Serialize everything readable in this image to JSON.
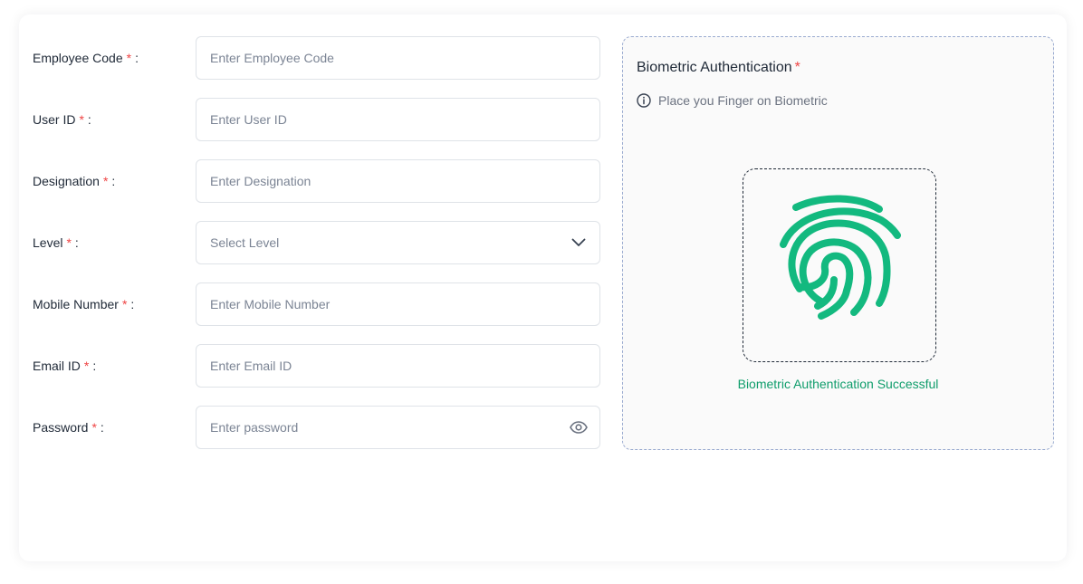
{
  "form": {
    "required_marker": "*",
    "separator": ":",
    "fields": [
      {
        "label": "Employee Code",
        "placeholder": "Enter Employee Code",
        "value": ""
      },
      {
        "label": "User ID",
        "placeholder": "Enter User ID",
        "value": ""
      },
      {
        "label": "Designation",
        "placeholder": "Enter Designation",
        "value": ""
      },
      {
        "label": "Level",
        "placeholder": "Select Level",
        "value": "",
        "type": "select",
        "icon": "chevron-down-icon"
      },
      {
        "label": "Mobile Number",
        "placeholder": "Enter Mobile Number",
        "value": ""
      },
      {
        "label": "Email ID",
        "placeholder": "Enter Email ID",
        "value": ""
      },
      {
        "label": "Password",
        "placeholder": "Enter password",
        "value": "",
        "type": "password",
        "icon": "eye-icon"
      }
    ]
  },
  "biometric": {
    "title": "Biometric Authentication",
    "required_marker": "*",
    "hint": "Place you Finger on Biometric",
    "hint_icon": "info-icon",
    "scanner_icon": "fingerprint-icon",
    "status": "Biometric Authentication Successful",
    "status_color": "#0f9d6b"
  },
  "colors": {
    "required": "#ef4444",
    "fingerprint": "#13b97f",
    "panel_border": "#9aabd0"
  }
}
